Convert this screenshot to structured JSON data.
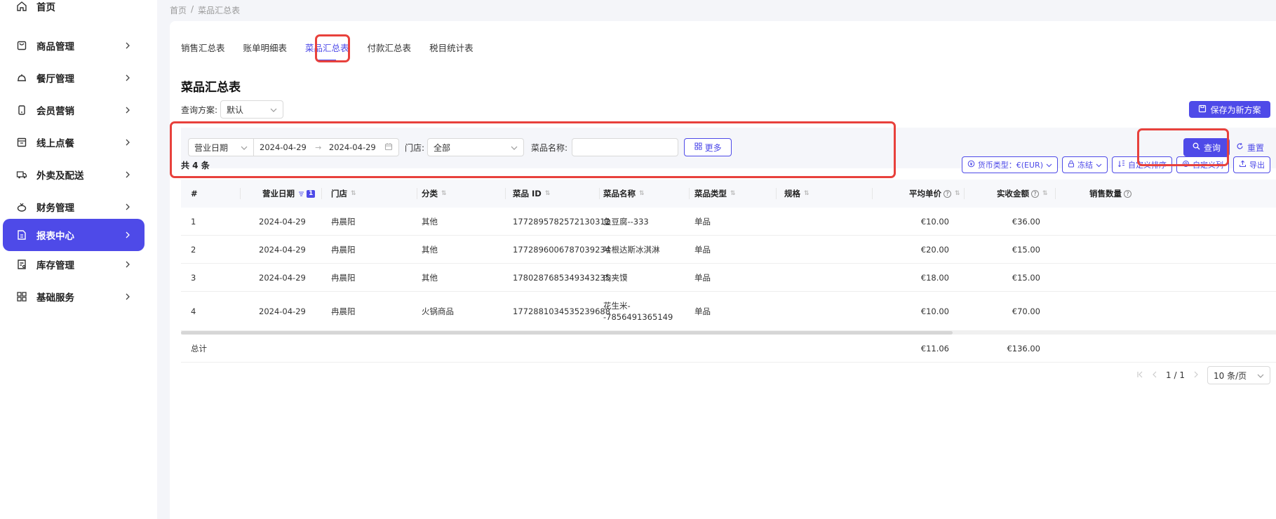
{
  "sidebar": {
    "items": [
      {
        "label": "首页",
        "icon": "home-icon",
        "has_arrow": false
      },
      {
        "label": "商品管理",
        "icon": "goods-icon",
        "has_arrow": true
      },
      {
        "label": "餐厅管理",
        "icon": "restaurant-icon",
        "has_arrow": true
      },
      {
        "label": "会员营销",
        "icon": "member-icon",
        "has_arrow": true
      },
      {
        "label": "线上点餐",
        "icon": "online-order-icon",
        "has_arrow": true
      },
      {
        "label": "外卖及配送",
        "icon": "delivery-icon",
        "has_arrow": true
      },
      {
        "label": "财务管理",
        "icon": "finance-icon",
        "has_arrow": true
      },
      {
        "label": "报表中心",
        "icon": "report-icon",
        "has_arrow": true,
        "active": true
      },
      {
        "label": "库存管理",
        "icon": "inventory-icon",
        "has_arrow": true
      },
      {
        "label": "基础服务",
        "icon": "grid-icon",
        "has_arrow": true
      }
    ]
  },
  "breadcrumb": {
    "home": "首页",
    "sep": "/",
    "current": "菜品汇总表"
  },
  "tabs": [
    {
      "label": "销售汇总表"
    },
    {
      "label": "账单明细表"
    },
    {
      "label": "菜品汇总表",
      "active": true
    },
    {
      "label": "付款汇总表"
    },
    {
      "label": "税目统计表"
    }
  ],
  "page_title": "菜品汇总表",
  "scheme": {
    "label": "查询方案:",
    "value": "默认"
  },
  "save_scheme_label": "保存为新方案",
  "filters": {
    "date_type": "营业日期",
    "date_start": "2024-04-29",
    "date_arrow": "→",
    "date_end": "2024-04-29",
    "store_label": "门店:",
    "store_value": "全部",
    "dish_name_label": "菜品名称:",
    "dish_name_value": "",
    "more_label": "更多",
    "query_label": "查询",
    "reset_label": "重置"
  },
  "table": {
    "count_text": "共 4 条",
    "tools": [
      {
        "label": "货币类型：€(EUR)",
        "icon": "currency-icon",
        "dropdown": true
      },
      {
        "label": "冻结",
        "icon": "lock-icon",
        "dropdown": true
      },
      {
        "label": "自定义排序",
        "icon": "sort-icon",
        "dropdown": false
      },
      {
        "label": "自定义列",
        "icon": "column-icon",
        "dropdown": false
      },
      {
        "label": "导出",
        "icon": "export-icon",
        "dropdown": false
      }
    ],
    "headers": [
      "#",
      "营业日期",
      "门店",
      "分类",
      "菜品 ID",
      "菜品名称",
      "菜品类型",
      "规格",
      "平均单价",
      "实收金额",
      "销售数量"
    ],
    "sort_badge": "1",
    "rows": [
      {
        "idx": "1",
        "date": "2024-04-29",
        "store": "冉晨阳",
        "category": "其他",
        "dish_id": "1772895782572130312",
        "name": "鱼豆腐--333",
        "name2": "",
        "type": "单品",
        "spec": "",
        "avg_price": "€10.00",
        "amount": "€36.00"
      },
      {
        "idx": "2",
        "date": "2024-04-29",
        "store": "冉晨阳",
        "category": "其他",
        "dish_id": "1772896006787039234",
        "name": "哈根达斯冰淇淋",
        "name2": "",
        "type": "单品",
        "spec": "",
        "avg_price": "€20.00",
        "amount": "€15.00"
      },
      {
        "idx": "3",
        "date": "2024-04-29",
        "store": "冉晨阳",
        "category": "其他",
        "dish_id": "1780287685349343235",
        "name": "肉夹馍",
        "name2": "",
        "type": "单品",
        "spec": "",
        "avg_price": "€18.00",
        "amount": "€15.00"
      },
      {
        "idx": "4",
        "date": "2024-04-29",
        "store": "冉晨阳",
        "category": "火锅商品",
        "dish_id": "1772881034535239688",
        "name": "花生米-",
        "name2": "-7856491365149",
        "type": "单品",
        "spec": "",
        "avg_price": "€10.00",
        "amount": "€70.00"
      }
    ],
    "total": {
      "label": "总计",
      "avg_price": "€11.06",
      "amount": "€136.00"
    }
  },
  "pagination": {
    "current": "1",
    "sep": "/",
    "total": "1",
    "page_size": "10 条/页"
  },
  "colors": {
    "primary": "#4e4ae8",
    "highlight": "#e8413c"
  }
}
